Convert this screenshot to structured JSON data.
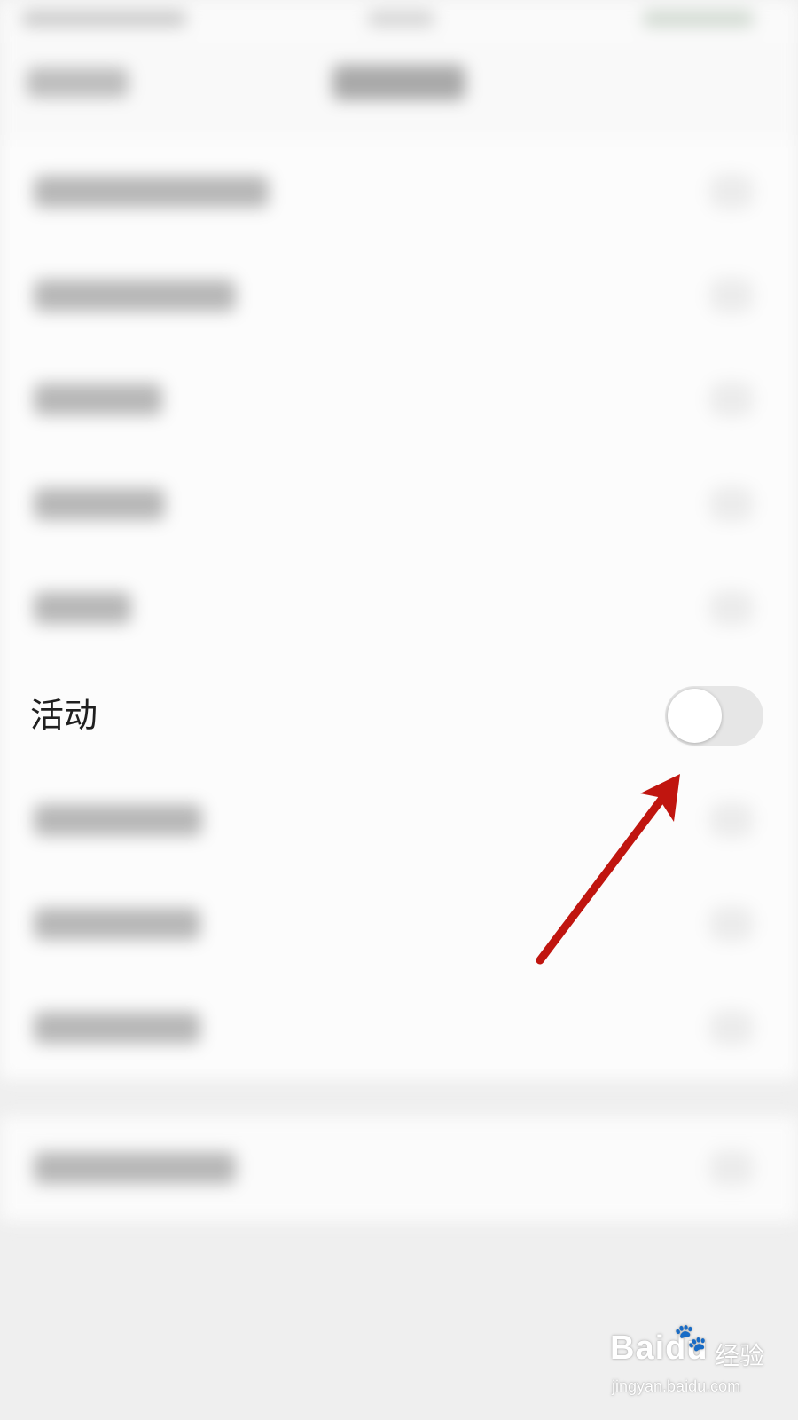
{
  "setting_row": {
    "label": "活动",
    "toggle_state": "off"
  },
  "watermark": {
    "logo_text": "Baidu",
    "logo_suffix": "经验",
    "url": "jingyan.baidu.com"
  },
  "annotation": {
    "arrow_color": "#c0150f"
  },
  "blurred_row_label_widths": [
    265,
    228,
    145,
    148,
    110,
    190,
    188,
    188,
    228
  ]
}
